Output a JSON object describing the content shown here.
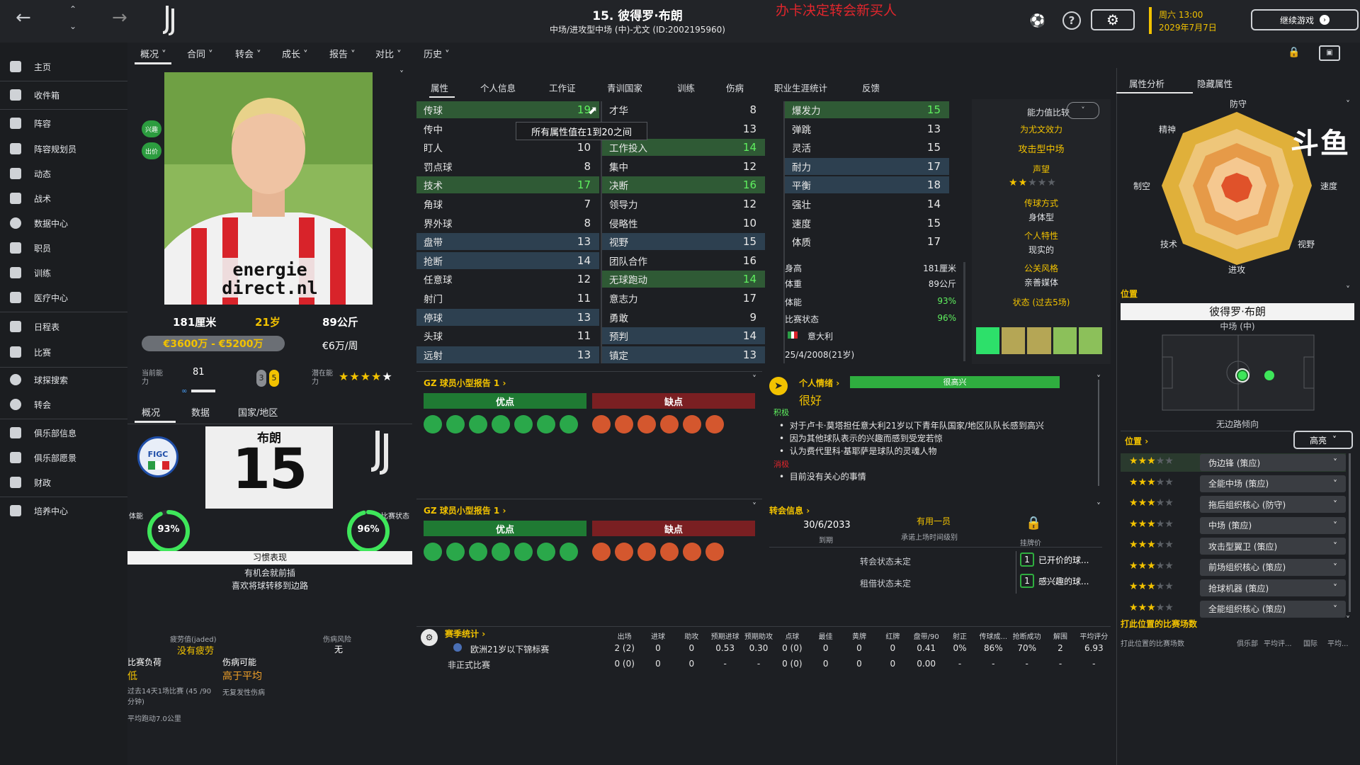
{
  "top": {
    "title": "15. 彼得罗·布朗",
    "subtitle": "中场/进攻型中场 (中)-尤文 (ID:2002195960)",
    "overlay_text": "办卡决定转会新买人",
    "date_day": "周六 13:00",
    "date_full": "2029年7月7日",
    "continue_label": "继续游戏",
    "help_glyph": "?"
  },
  "menu": [
    "概况",
    "合同",
    "转会",
    "成长",
    "报告",
    "对比",
    "历史"
  ],
  "sidebar": [
    {
      "label": "主页",
      "icon": "home-icon"
    },
    {
      "label": "收件箱",
      "icon": "inbox-icon"
    },
    {
      "label": "阵容",
      "icon": "squad-icon"
    },
    {
      "label": "阵容规划员",
      "icon": "planner-icon"
    },
    {
      "label": "动态",
      "icon": "dynamics-icon"
    },
    {
      "label": "战术",
      "icon": "tactics-icon"
    },
    {
      "label": "数据中心",
      "icon": "data-hub-icon"
    },
    {
      "label": "职员",
      "icon": "staff-icon"
    },
    {
      "label": "训练",
      "icon": "training-icon"
    },
    {
      "label": "医疗中心",
      "icon": "medical-icon"
    },
    {
      "label": "日程表",
      "icon": "schedule-icon"
    },
    {
      "label": "比赛",
      "icon": "trophy-icon"
    },
    {
      "label": "球探搜索",
      "icon": "scouting-icon"
    },
    {
      "label": "转会",
      "icon": "transfer-icon"
    },
    {
      "label": "俱乐部信息",
      "icon": "club-info-icon"
    },
    {
      "label": "俱乐部愿景",
      "icon": "club-vision-icon"
    },
    {
      "label": "财政",
      "icon": "finance-icon"
    },
    {
      "label": "培养中心",
      "icon": "development-icon"
    }
  ],
  "profile": {
    "pill1": "兴趣",
    "pill2": "出价",
    "height": "181厘米",
    "age": "21岁",
    "weight": "89公斤",
    "value": "€3600万 - €5200万",
    "wage": "€6万/周",
    "ca_label": "当前能力",
    "ca_value": "81",
    "pa_label": "潜在能力",
    "badge1": "3",
    "badge2": "5",
    "pa_stars": 5,
    "tabs": [
      "概况",
      "数据",
      "国家/地区"
    ],
    "shirt_name": "布朗",
    "shirt_number": "15",
    "figc": "FIGC",
    "fitness_label": "体能",
    "fitness": "93%",
    "fitness_pct": 93,
    "form_label": "比赛状态",
    "form": "96%",
    "form_pct": 96,
    "habits_title": "习惯表现",
    "habits": [
      "有机会就前插",
      "喜欢将球转移到边路"
    ],
    "fatigue_label": "疲劳值(jaded)",
    "fatigue_value": "没有疲劳",
    "injury_risk_label": "伤病风险",
    "injury_risk_value": "无",
    "load_label": "比赛负荷",
    "load_value": "低",
    "injury_chance_label": "伤病可能",
    "injury_chance_value": "高于平均",
    "load_note": "过去14天1场比赛 (45 /90分钟)",
    "injury_note": "无复发性伤病",
    "distance_note": "平均跑动7.0公里"
  },
  "attr_tabs": [
    "属性",
    "个人信息",
    "工作证",
    "青训国家",
    "训练",
    "伤病",
    "职业生涯统计",
    "反馈"
  ],
  "tooltip": "所有属性值在1到20之间",
  "technical": [
    {
      "n": "传球",
      "v": "19",
      "hl": "green"
    },
    {
      "n": "传中",
      "v": "9",
      "hl": ""
    },
    {
      "n": "盯人",
      "v": "10",
      "hl": ""
    },
    {
      "n": "罚点球",
      "v": "8",
      "hl": ""
    },
    {
      "n": "技术",
      "v": "17",
      "hl": "green"
    },
    {
      "n": "角球",
      "v": "7",
      "hl": ""
    },
    {
      "n": "界外球",
      "v": "8",
      "hl": ""
    },
    {
      "n": "盘带",
      "v": "13",
      "hl": "blue"
    },
    {
      "n": "抢断",
      "v": "14",
      "hl": "blue"
    },
    {
      "n": "任意球",
      "v": "12",
      "hl": ""
    },
    {
      "n": "射门",
      "v": "11",
      "hl": ""
    },
    {
      "n": "停球",
      "v": "13",
      "hl": "blue"
    },
    {
      "n": "头球",
      "v": "11",
      "hl": ""
    },
    {
      "n": "远射",
      "v": "13",
      "hl": "blue"
    }
  ],
  "mental": [
    {
      "n": "才华",
      "v": "8",
      "hl": ""
    },
    {
      "n": "镇",
      "v": "13",
      "hl": ""
    },
    {
      "n": "工作投入",
      "v": "14",
      "hl": "green"
    },
    {
      "n": "集中",
      "v": "12",
      "hl": ""
    },
    {
      "n": "决断",
      "v": "16",
      "hl": "green"
    },
    {
      "n": "领导力",
      "v": "12",
      "hl": ""
    },
    {
      "n": "侵略性",
      "v": "10",
      "hl": ""
    },
    {
      "n": "视野",
      "v": "15",
      "hl": "blue"
    },
    {
      "n": "团队合作",
      "v": "16",
      "hl": ""
    },
    {
      "n": "无球跑动",
      "v": "14",
      "hl": "green"
    },
    {
      "n": "意志力",
      "v": "17",
      "hl": ""
    },
    {
      "n": "勇敢",
      "v": "9",
      "hl": ""
    },
    {
      "n": "预判",
      "v": "14",
      "hl": "blue"
    },
    {
      "n": "镇定",
      "v": "13",
      "hl": "blue"
    }
  ],
  "physical": [
    {
      "n": "爆发力",
      "v": "15",
      "hl": "green"
    },
    {
      "n": "弹跳",
      "v": "13",
      "hl": ""
    },
    {
      "n": "灵活",
      "v": "15",
      "hl": ""
    },
    {
      "n": "耐力",
      "v": "17",
      "hl": "blue"
    },
    {
      "n": "平衡",
      "v": "18",
      "hl": "blue"
    },
    {
      "n": "强壮",
      "v": "14",
      "hl": ""
    },
    {
      "n": "速度",
      "v": "15",
      "hl": ""
    },
    {
      "n": "体质",
      "v": "17",
      "hl": ""
    }
  ],
  "info": {
    "height_label": "身高",
    "height": "181厘米",
    "weight_label": "体重",
    "weight": "89公斤",
    "fitness_label": "体能",
    "fitness": "93%",
    "form_label": "比赛状态",
    "form": "96%",
    "nation": "意大利",
    "dob": "25/4/2008(21岁)"
  },
  "compare": {
    "label": "能力值比较",
    "team": "为尤文效力",
    "role": "攻击型中场",
    "rep_label": "声望",
    "rep_stars": 2,
    "style_label": "传球方式",
    "style_value": "身体型",
    "trait_label": "个人特性",
    "trait_value": "现实的",
    "media_label": "公关风格",
    "media_value": "亲善媒体",
    "form_label": "状态 (过去5场)",
    "form_blocks": [
      "#2de06a",
      "#b5a655",
      "#b5a655",
      "#8cc05a",
      "#8cc05a"
    ]
  },
  "report1": {
    "title": "GZ 球员小型报告 1",
    "pros": "优点",
    "cons": "缺点",
    "pros_icons": 7,
    "cons_icons": 6
  },
  "report2": {
    "title": "GZ 球员小型报告 1",
    "pros": "优点",
    "cons": "缺点"
  },
  "mood": {
    "title": "个人情绪",
    "bar": "很高兴",
    "status": "很好",
    "positive_label": "积极",
    "positives": [
      "对于卢卡·莫塔担任意大利21岁以下青年队国家/地区队队长感到高兴",
      "因为其他球队表示的兴趣而感到受宠若惊",
      "认为费代里科·基耶萨是球队的灵魂人物"
    ],
    "negative_label": "消极",
    "negatives": [
      "目前没有关心的事情"
    ]
  },
  "transfer": {
    "title": "转会信息",
    "expiry": "30/6/2033",
    "expiry_label": "到期",
    "squad_status": "有用一员",
    "squad_sub": "承诺上场时间级别",
    "asking_label": "挂牌价",
    "status_label": "转会状态未定",
    "loan_label": "租借状态未定",
    "bid_count": "1",
    "bid_text": "已开价的球...",
    "interest_count": "1",
    "interest_text": "感兴趣的球..."
  },
  "stats": {
    "title": "赛季统计",
    "headers": [
      "出场",
      "进球",
      "助攻",
      "预期进球",
      "预期助攻",
      "点球",
      "最佳",
      "黄牌",
      "红牌",
      "盘带/90",
      "射正",
      "传球成...",
      "抢断成功",
      "解围",
      "平均评分"
    ],
    "rows": [
      {
        "name": "欧洲21岁以下锦标赛",
        "vals": [
          "2 (2)",
          "0",
          "0",
          "0.53",
          "0.30",
          "0 (0)",
          "0",
          "0",
          "0",
          "0.41",
          "0%",
          "86%",
          "70%",
          "2",
          "6.93"
        ]
      },
      {
        "name": "非正式比赛",
        "vals": [
          "0 (0)",
          "0",
          "0",
          "-",
          "-",
          "0 (0)",
          "0",
          "0",
          "0",
          "0.00",
          "-",
          "-",
          "-",
          "-",
          "-"
        ]
      }
    ]
  },
  "right": {
    "tabs": [
      "属性分析",
      "隐藏属性"
    ],
    "radar_labels": [
      "防守",
      "速度",
      "视野",
      "进攻",
      "技术",
      "制空",
      "精神"
    ],
    "watermark": "斗鱼",
    "position_label": "位置",
    "player_name": "彼得罗·布朗",
    "player_pos": "中场 (中)",
    "tendency": "无边路倾向",
    "positions_label": "位置",
    "highlight": "高亮",
    "roles": [
      {
        "stars": 3,
        "role": "伪边锋 (策应)"
      },
      {
        "stars": 3,
        "role": "全能中场 (策应)"
      },
      {
        "stars": 3,
        "role": "拖后组织核心 (防守)"
      },
      {
        "stars": 3,
        "role": "中场 (策应)"
      },
      {
        "stars": 3,
        "role": "攻击型翼卫 (策应)"
      },
      {
        "stars": 3,
        "role": "前场组织核心 (策应)"
      },
      {
        "stars": 3,
        "role": "抢球机器 (策应)"
      },
      {
        "stars": 3,
        "role": "全能组织核心 (策应)"
      }
    ],
    "apps_label": "打此位置的比赛场数",
    "apps_sub": "打此位置的比赛场数",
    "apps_cols": [
      "俱乐部",
      "平均评...",
      "国际",
      "平均..."
    ]
  },
  "colors": {
    "accent": "#f2c200",
    "green": "#5ff05f",
    "red": "#d4572e"
  }
}
